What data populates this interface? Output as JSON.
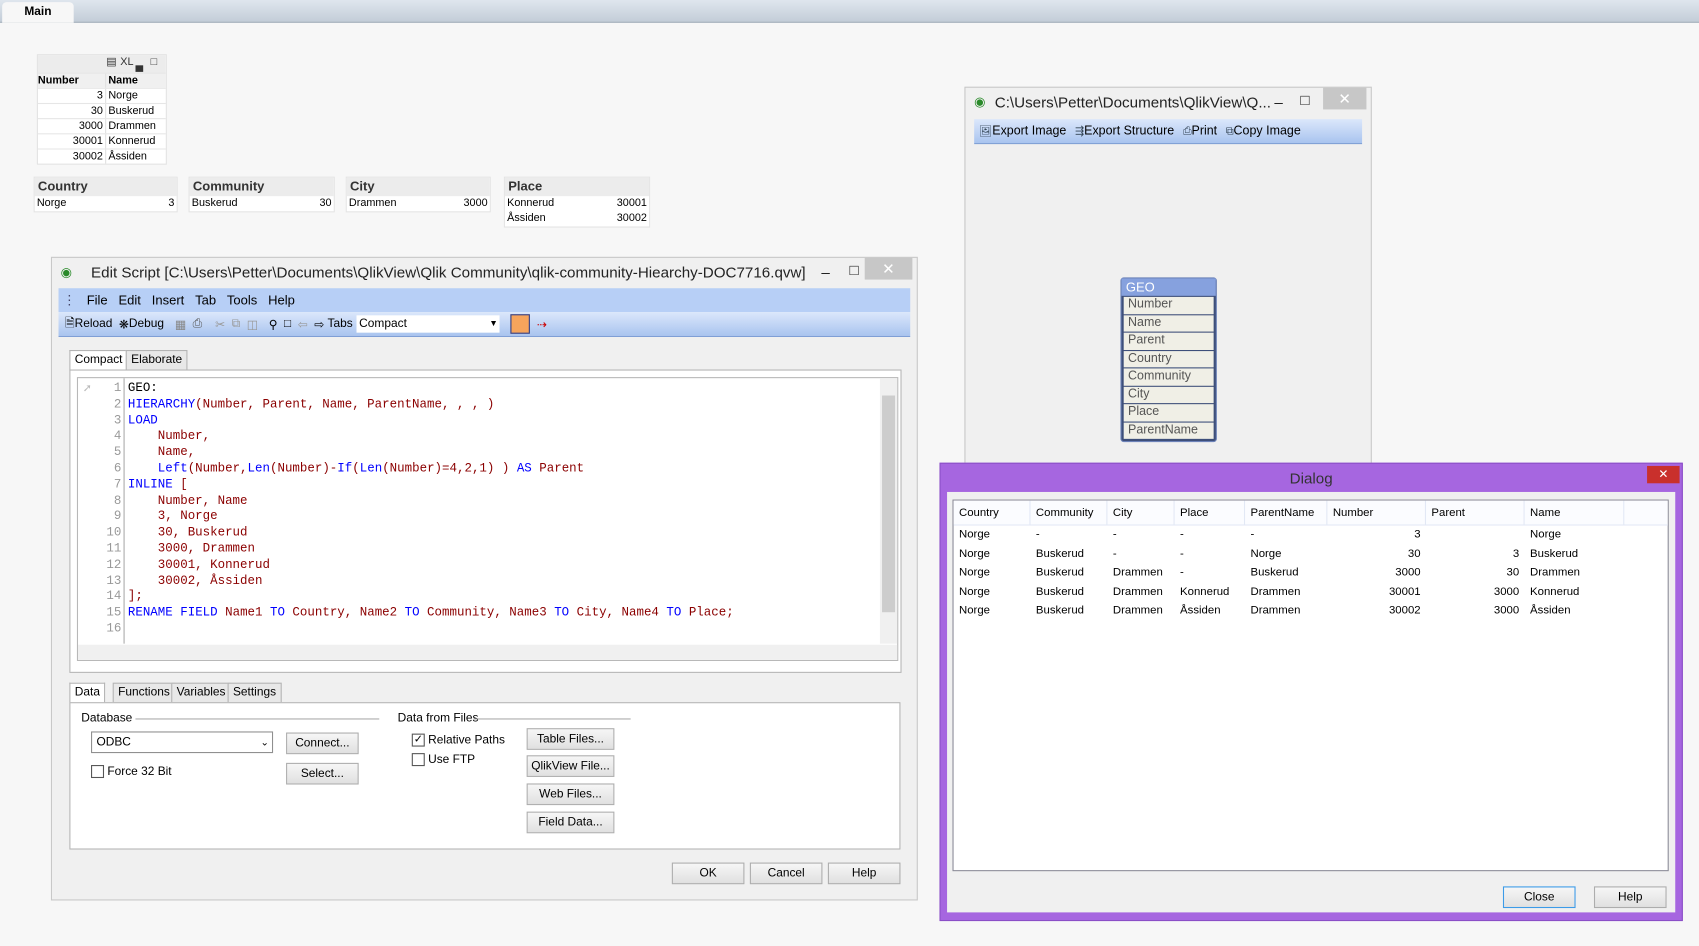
{
  "sheet_tabs": [
    {
      "label": "Main",
      "active": true
    }
  ],
  "table_box": {
    "caption_icons": [
      "print-icon",
      "xl-export-icon",
      "minimize-icon",
      "maximize-icon"
    ],
    "caption_xl": "XL",
    "columns": [
      "Number",
      "Name"
    ],
    "rows": [
      [
        "3",
        "Norge"
      ],
      [
        "30",
        "Buskerud"
      ],
      [
        "3000",
        "Drammen"
      ],
      [
        "30001",
        "Konnerud"
      ],
      [
        "30002",
        "Åssiden"
      ]
    ]
  },
  "list_boxes": [
    {
      "title": "Country",
      "items": [
        [
          "Norge",
          "3"
        ]
      ]
    },
    {
      "title": "Community",
      "items": [
        [
          "Buskerud",
          "30"
        ]
      ]
    },
    {
      "title": "City",
      "items": [
        [
          "Drammen",
          "3000"
        ]
      ]
    },
    {
      "title": "Place",
      "items": [
        [
          "Konnerud",
          "30001"
        ],
        [
          "Åssiden",
          "30002"
        ]
      ]
    }
  ],
  "edit_script": {
    "title": "Edit Script [C:\\Users\\Petter\\Documents\\QlikView\\Qlik Community\\qlik-community-Hiearchy-DOC7716.qvw]",
    "menu": [
      "File",
      "Edit",
      "Insert",
      "Tab",
      "Tools",
      "Help"
    ],
    "toolbar": {
      "reload": "Reload",
      "debug": "Debug",
      "tabs_label": "Tabs",
      "tabs_value": "Compact"
    },
    "script_tabs": [
      "Compact",
      "Elaborate"
    ],
    "active_script_tab": "Compact",
    "code_lines": [
      [
        [
          "p",
          "GEO:"
        ]
      ],
      [
        [
          "k",
          "HIERARCHY"
        ],
        [
          "f",
          "(Number, Parent, Name, ParentName, , , )"
        ]
      ],
      [
        [
          "k",
          "LOAD"
        ]
      ],
      [
        [
          "f",
          "    Number,"
        ]
      ],
      [
        [
          "f",
          "    Name,"
        ]
      ],
      [
        [
          "p",
          "    "
        ],
        [
          "k",
          "Left"
        ],
        [
          "f",
          "(Number,"
        ],
        [
          "k",
          "Len"
        ],
        [
          "f",
          "(Number)-"
        ],
        [
          "k",
          "If"
        ],
        [
          "f",
          "("
        ],
        [
          "k",
          "Len"
        ],
        [
          "f",
          "(Number)=4,2,1) ) "
        ],
        [
          "k",
          "AS"
        ],
        [
          "f",
          " Parent"
        ]
      ],
      [
        [
          "k",
          "INLINE"
        ],
        [
          "f",
          " ["
        ]
      ],
      [
        [
          "f",
          "    Number, Name"
        ]
      ],
      [
        [
          "f",
          "    3, Norge"
        ]
      ],
      [
        [
          "f",
          "    30, Buskerud"
        ]
      ],
      [
        [
          "f",
          "    3000, Drammen"
        ]
      ],
      [
        [
          "f",
          "    30001, Konnerud"
        ]
      ],
      [
        [
          "f",
          "    30002, Åssiden"
        ]
      ],
      [
        [
          "f",
          "];"
        ]
      ],
      [
        [
          "k",
          "RENAME"
        ],
        [
          "p",
          " "
        ],
        [
          "k",
          "FIELD"
        ],
        [
          "f",
          " Name1 "
        ],
        [
          "k",
          "TO"
        ],
        [
          "f",
          " Country, Name2 "
        ],
        [
          "k",
          "TO"
        ],
        [
          "f",
          " Community, Name3 "
        ],
        [
          "k",
          "TO"
        ],
        [
          "f",
          " City, Name4 "
        ],
        [
          "k",
          "TO"
        ],
        [
          "f",
          " Place;"
        ]
      ],
      []
    ],
    "bottom_tabs": [
      "Data",
      "Functions",
      "Variables",
      "Settings"
    ],
    "database": {
      "label": "Database",
      "value": "ODBC",
      "connect": "Connect...",
      "select": "Select...",
      "force32": "Force 32 Bit",
      "force32_checked": false
    },
    "files": {
      "label": "Data from Files",
      "relative_paths": "Relative Paths",
      "relative_paths_checked": true,
      "use_ftp": "Use FTP",
      "use_ftp_checked": false,
      "table_files": "Table Files...",
      "qlikview_file": "QlikView File...",
      "web_files": "Web Files...",
      "field_data": "Field Data..."
    },
    "buttons": {
      "ok": "OK",
      "cancel": "Cancel",
      "help": "Help"
    }
  },
  "table_viewer": {
    "title": "C:\\Users\\Petter\\Documents\\QlikView\\Q...",
    "toolbar": [
      "Export Image",
      "Export Structure",
      "Print",
      "Copy Image"
    ],
    "table": {
      "name": "GEO",
      "fields": [
        "Number",
        "Name",
        "Parent",
        "Country",
        "Community",
        "City",
        "Place",
        "ParentName"
      ]
    }
  },
  "dialog": {
    "title": "Dialog",
    "accent": "#a666e0",
    "columns": [
      "Country",
      "Community",
      "City",
      "Place",
      "ParentName",
      "Number",
      "Parent",
      "Name"
    ],
    "rows": [
      [
        "Norge",
        "-",
        "-",
        "-",
        "-",
        "3",
        "",
        "Norge"
      ],
      [
        "Norge",
        "Buskerud",
        "-",
        "-",
        "Norge",
        "30",
        "3",
        "Buskerud"
      ],
      [
        "Norge",
        "Buskerud",
        "Drammen",
        "-",
        "Buskerud",
        "3000",
        "30",
        "Drammen"
      ],
      [
        "Norge",
        "Buskerud",
        "Drammen",
        "Konnerud",
        "Drammen",
        "30001",
        "3000",
        "Konnerud"
      ],
      [
        "Norge",
        "Buskerud",
        "Drammen",
        "Åssiden",
        "Drammen",
        "30002",
        "3000",
        "Åssiden"
      ]
    ],
    "close": "Close",
    "help": "Help"
  }
}
